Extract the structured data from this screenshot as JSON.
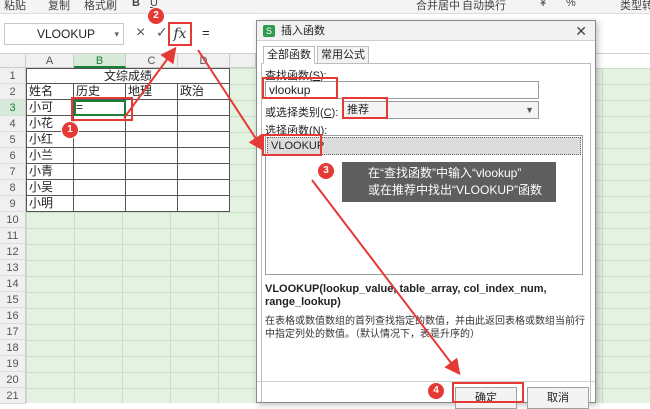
{
  "toolbar": {
    "items": [
      "粘贴",
      "复制",
      "格式刷",
      "B",
      "U",
      "合并居中",
      "自动换行",
      "¥",
      "%",
      "类型转"
    ]
  },
  "formula_bar": {
    "name_box": "VLOOKUP",
    "cancel_icon": "×",
    "confirm_icon": "✓",
    "fx_label": "fx",
    "formula": "="
  },
  "sheet": {
    "columns": [
      "A",
      "B",
      "C",
      "D"
    ],
    "rows": [
      "1",
      "2",
      "3",
      "4",
      "5",
      "6",
      "7",
      "8",
      "9",
      "10",
      "11",
      "12",
      "13",
      "14",
      "15",
      "16",
      "17",
      "18",
      "19",
      "20",
      "21"
    ],
    "title": "文综成绩",
    "headers": [
      "姓名",
      "历史",
      "地理",
      "政治"
    ],
    "names": [
      "小可",
      "小花",
      "小红",
      "小兰",
      "小青",
      "小吴",
      "小明"
    ],
    "active_value": "="
  },
  "dialog": {
    "title": "插入函数",
    "close": "✕",
    "tabs": [
      "全部函数",
      "常用公式"
    ],
    "search_label": "查找函数(",
    "search_key": "S",
    "search_suffix": "):",
    "search_value": "vlookup",
    "category_label": "或选择类别(",
    "category_key": "C",
    "category_suffix": "):",
    "category_value": "推荐",
    "list_label": "选择函数(",
    "list_key": "N",
    "list_suffix": "):",
    "functions": [
      "VLOOKUP"
    ],
    "signature": "VLOOKUP(lookup_value, table_array, col_index_num, range_lookup)",
    "description": "在表格或数值数组的首列查找指定的数值，并由此返回表格或数组当前行中指定列处的数值。（默认情况下，表是升序的）",
    "ok": "确定",
    "cancel": "取消"
  },
  "annotations": {
    "badges": [
      "1",
      "2",
      "3",
      "4"
    ],
    "tooltip_line1": "在“查找函数”中输入“vlookup”",
    "tooltip_line2": "或在推荐中找出“VLOOKUP”函数",
    "color": "#e53935"
  }
}
